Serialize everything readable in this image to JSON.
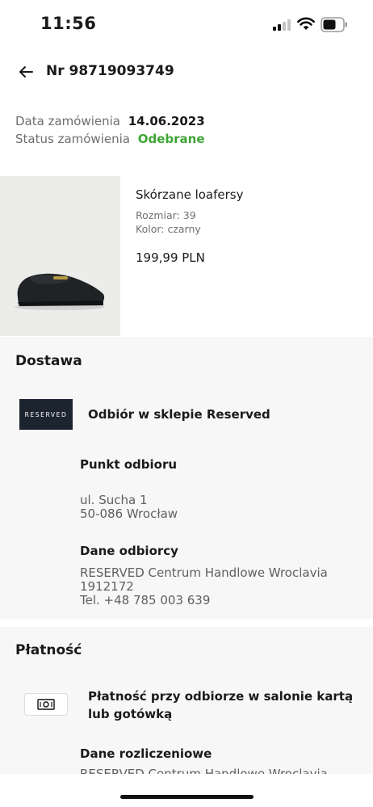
{
  "status_bar": {
    "time": "11:56"
  },
  "header": {
    "order_number": "Nr 98719093749"
  },
  "order": {
    "date_label": "Data zamówienia",
    "date_value": "14.06.2023",
    "status_label": "Status zamówienia",
    "status_value": "Odebrane",
    "status_color": "#3fa535"
  },
  "product": {
    "name": "Skórzane loafersy",
    "size": "Rozmiar: 39",
    "color": "Kolor: czarny",
    "price": "199,99 PLN"
  },
  "delivery": {
    "title": "Dostawa",
    "logo_text": "RESERVED",
    "method": "Odbiór w sklepie Reserved",
    "pickup_title": "Punkt odbioru",
    "pickup_address_1": "ul. Sucha 1",
    "pickup_address_2": "50-086 Wrocław",
    "recipient_title": "Dane odbiorcy",
    "recipient_line_1": "RESERVED Centrum Handlowe Wroclavia",
    "recipient_line_2": "1912172",
    "recipient_line_3": "Tel. +48 785 003 639"
  },
  "payment": {
    "title": "Płatność",
    "method": "Płatność przy odbiorze w salonie kartą lub gotówką",
    "billing_title": "Dane rozliczeniowe",
    "billing_line_1": "RESERVED Centrum Handlowe Wroclavia"
  },
  "icons": {
    "back": "arrow-left-icon",
    "cash": "cash-icon",
    "signal": "cellular-signal-icon",
    "wifi": "wifi-icon",
    "battery": "battery-icon"
  }
}
